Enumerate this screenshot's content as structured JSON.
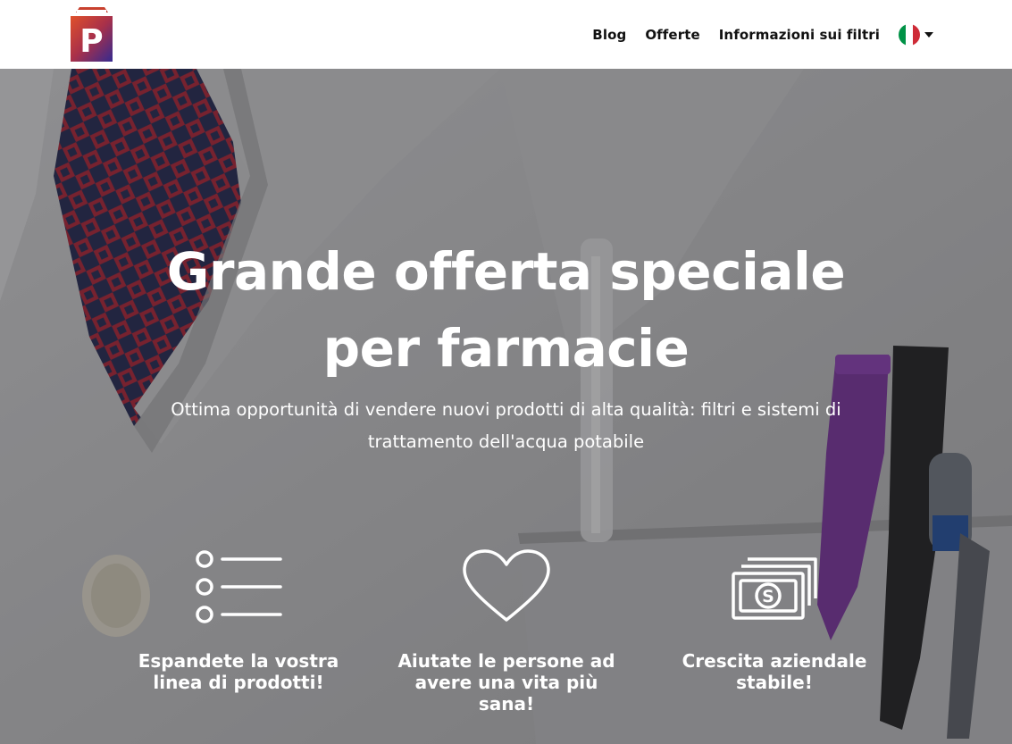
{
  "header": {
    "logo_letter": "P",
    "nav": {
      "blog": "Blog",
      "offers": "Offerte",
      "filters_info": "Informazioni sui filtri"
    },
    "language": {
      "flag": "italian-flag-icon",
      "colors": [
        "#009246",
        "#ffffff",
        "#ce2b37"
      ]
    }
  },
  "hero": {
    "title_line1": "Grande offerta speciale",
    "title_line2": "per farmacie",
    "subtitle": "Ottima opportunità di vendere nuovi prodotti di alta qualità: filtri e sistemi di trattamento dell'acqua potabile",
    "features": [
      {
        "icon": "list-icon",
        "text": "Espandete la vostra linea di prodotti!"
      },
      {
        "icon": "heart-icon",
        "text": "Aiutate le persone ad avere una vita più sana!"
      },
      {
        "icon": "money-stack-icon",
        "text": "Crescita aziendale stabile!"
      }
    ]
  },
  "colors": {
    "logo_gradient_start": "#d94a2a",
    "logo_gradient_end": "#3b2a8c",
    "text_dark": "#111111",
    "text_light": "#ffffff"
  }
}
